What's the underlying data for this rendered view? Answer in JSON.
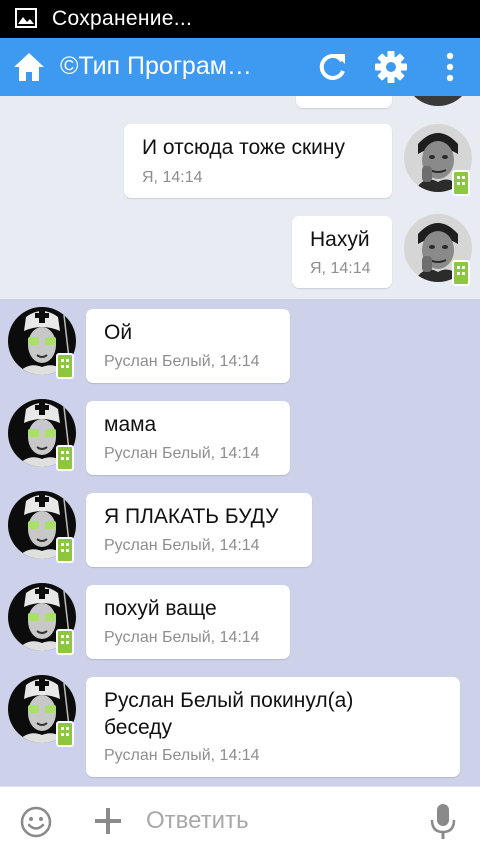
{
  "status_bar": {
    "text": "Сохранение...",
    "icon": "image-icon"
  },
  "app_bar": {
    "title": "©Тип Програм…",
    "icons": [
      "home-icon",
      "refresh-icon",
      "settings-icon",
      "more-vert-icon"
    ]
  },
  "messages_out": [
    {
      "text": "",
      "meta": ""
    },
    {
      "text": "И отсюда тоже скину",
      "meta": "Я, 14:14"
    },
    {
      "text": "Нахуй",
      "meta": "Я, 14:14"
    }
  ],
  "messages_in": [
    {
      "text": "Ой",
      "meta": "Руслан Белый, 14:14"
    },
    {
      "text": "мама",
      "meta": "Руслан Белый, 14:14"
    },
    {
      "text": "Я ПЛАКАТЬ БУДУ",
      "meta": "Руслан Белый, 14:14"
    },
    {
      "text": "похуй ваще",
      "meta": "Руслан Белый, 14:14"
    },
    {
      "text_line1": "Руслан Белый покинул(а)",
      "text_line2": "беседу",
      "meta": "Руслан Белый, 14:14"
    }
  ],
  "composer": {
    "placeholder": "Ответить"
  },
  "colors": {
    "app_bar": "#3d9af0",
    "in_area": "#cdd1ea",
    "out_area": "#e8ebf2",
    "badge": "#8dc63f"
  }
}
